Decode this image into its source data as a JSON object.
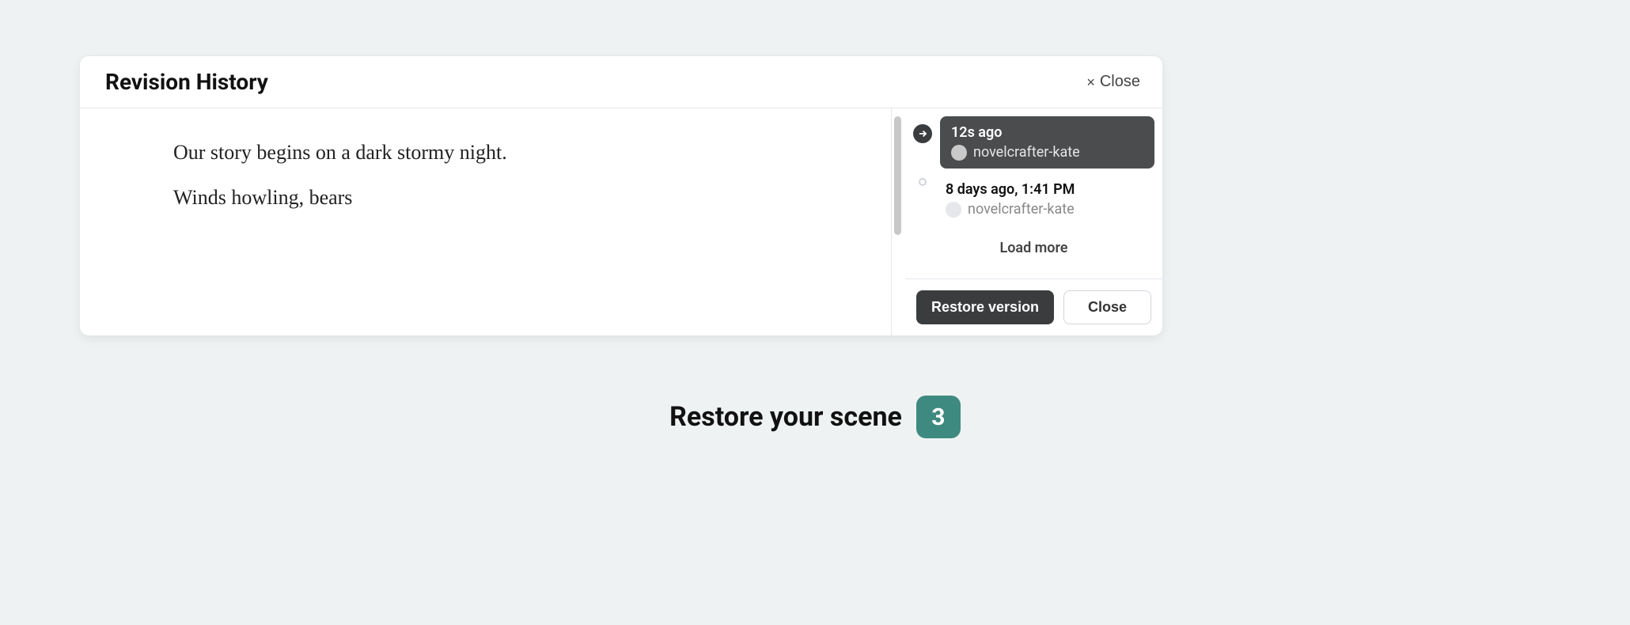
{
  "modal": {
    "title": "Revision History",
    "close_label": "Close"
  },
  "content": {
    "paragraphs": [
      "Our story begins on a dark stormy night.",
      "Winds howling, bears"
    ]
  },
  "revisions": [
    {
      "time": "12s ago",
      "author": "novelcrafter-kate",
      "active": true
    },
    {
      "time": "8 days ago, 1:41 PM",
      "author": "novelcrafter-kate",
      "active": false
    }
  ],
  "sidebar": {
    "load_more": "Load more",
    "restore_label": "Restore version",
    "close_label": "Close"
  },
  "caption": {
    "text": "Restore your scene",
    "step": "3"
  }
}
